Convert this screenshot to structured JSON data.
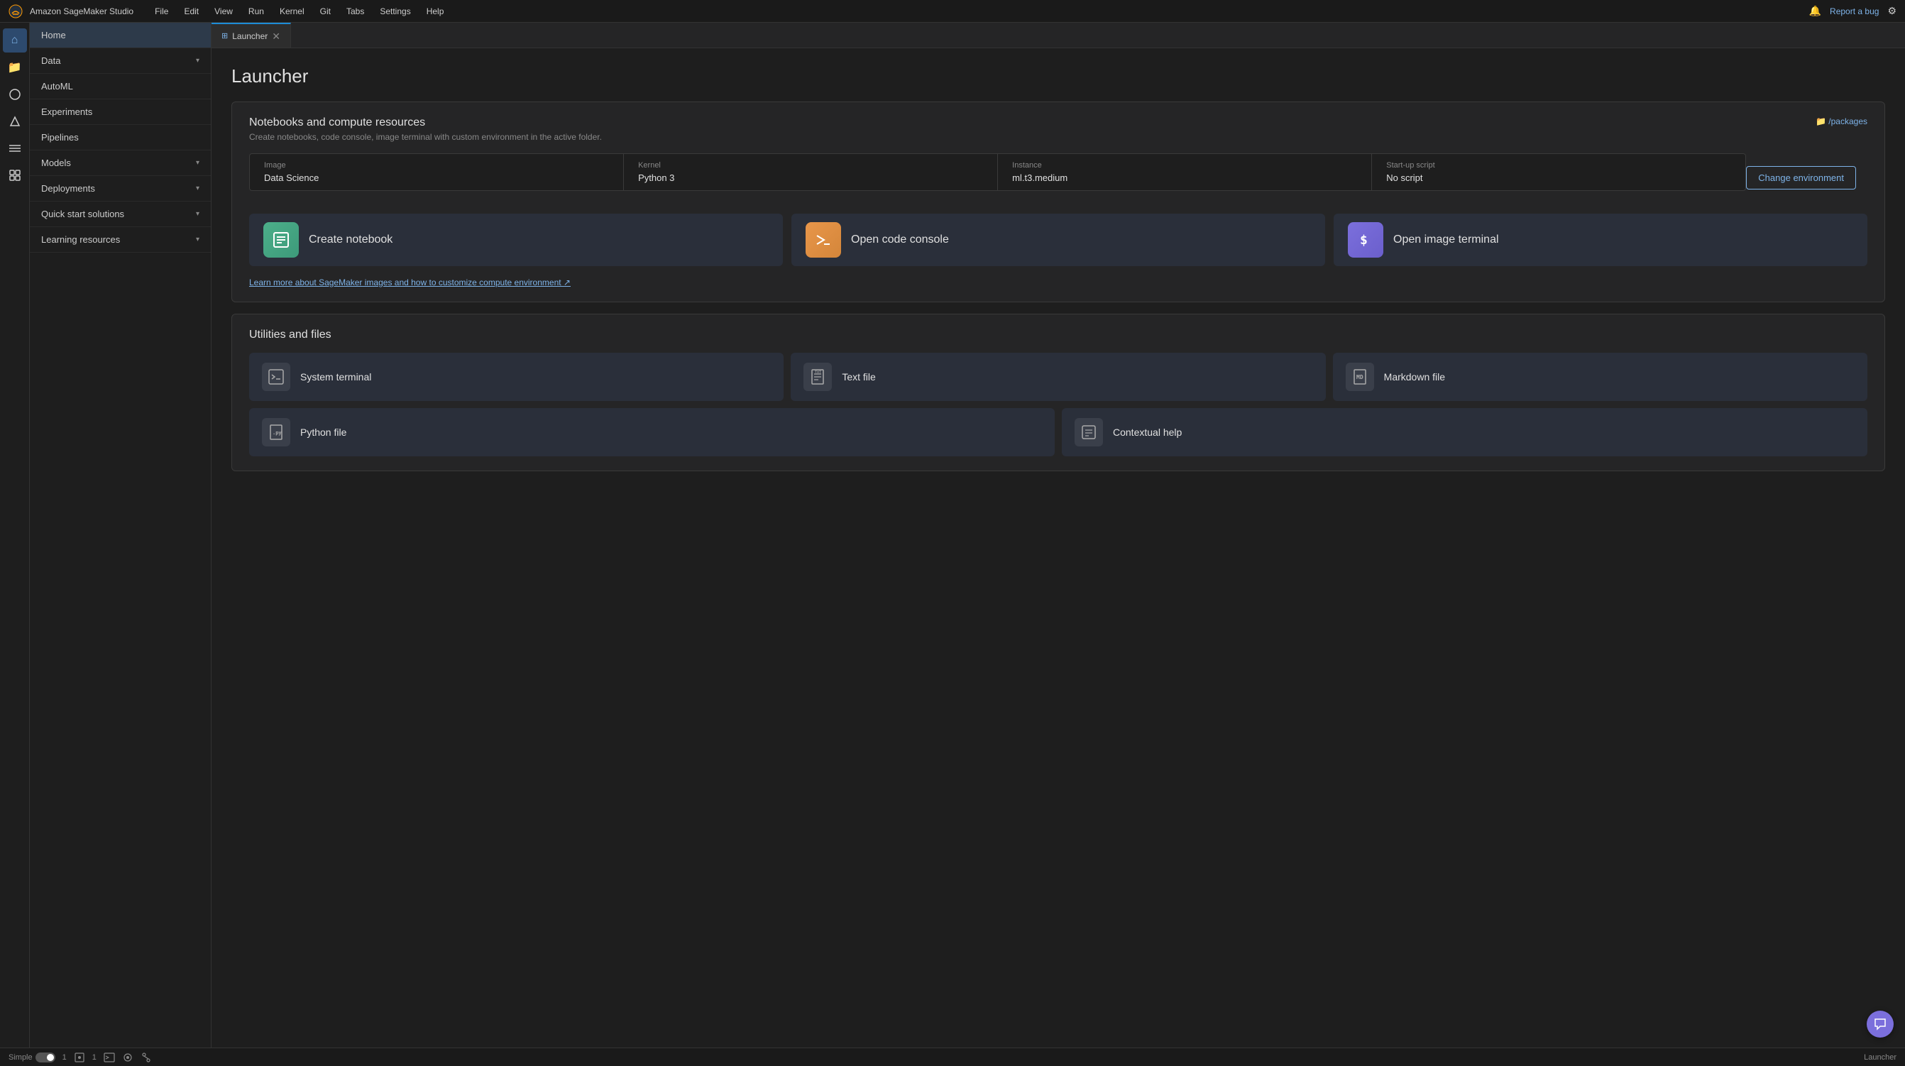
{
  "app": {
    "title": "Amazon SageMaker Studio",
    "report_bug": "Report a bug"
  },
  "menu": {
    "items": [
      "File",
      "Edit",
      "View",
      "Run",
      "Kernel",
      "Git",
      "Tabs",
      "Settings",
      "Help"
    ]
  },
  "icon_sidebar": {
    "items": [
      {
        "name": "home",
        "icon": "⌂",
        "active": true
      },
      {
        "name": "files",
        "icon": "📁",
        "active": false
      },
      {
        "name": "circle",
        "icon": "⬤",
        "active": false
      },
      {
        "name": "experiments",
        "icon": "◆",
        "active": false
      },
      {
        "name": "pipelines",
        "icon": "☰",
        "active": false
      },
      {
        "name": "puzzle",
        "icon": "🧩",
        "active": false
      }
    ]
  },
  "sidebar": {
    "items": [
      {
        "label": "Home",
        "has_chevron": false,
        "active": true
      },
      {
        "label": "Data",
        "has_chevron": true,
        "active": false
      },
      {
        "label": "AutoML",
        "has_chevron": false,
        "active": false
      },
      {
        "label": "Experiments",
        "has_chevron": false,
        "active": false
      },
      {
        "label": "Pipelines",
        "has_chevron": false,
        "active": false
      },
      {
        "label": "Models",
        "has_chevron": true,
        "active": false
      },
      {
        "label": "Deployments",
        "has_chevron": true,
        "active": false
      },
      {
        "label": "Quick start solutions",
        "has_chevron": true,
        "active": false
      },
      {
        "label": "Learning resources",
        "has_chevron": true,
        "active": false
      }
    ]
  },
  "tab": {
    "label": "Launcher",
    "icon": "⊞"
  },
  "launcher": {
    "title": "Launcher",
    "notebooks_section": {
      "title": "Notebooks and compute resources",
      "subtitle": "Create notebooks, code console, image terminal with custom environment in the active folder.",
      "folder_link": "📁 /packages",
      "env": {
        "image_label": "Image",
        "image_value": "Data Science",
        "kernel_label": "Kernel",
        "kernel_value": "Python 3",
        "instance_label": "Instance",
        "instance_value": "ml.t3.medium",
        "startup_label": "Start-up script",
        "startup_value": "No script",
        "change_btn": "Change environment"
      },
      "actions": [
        {
          "label": "Create notebook",
          "icon": "🖼",
          "name": "create-notebook"
        },
        {
          "label": "Open code console",
          "icon": "▶",
          "name": "open-code-console"
        },
        {
          "label": "Open image terminal",
          "icon": "$",
          "name": "open-image-terminal"
        }
      ],
      "learn_link": "Learn more about SageMaker images and how to customize compute environment ↗"
    },
    "utilities_section": {
      "title": "Utilities and files",
      "items": [
        {
          "label": "System terminal",
          "icon": "⬢",
          "name": "system-terminal"
        },
        {
          "label": "Text file",
          "icon": "📄",
          "name": "text-file"
        },
        {
          "label": "Markdown file",
          "icon": "📝",
          "name": "markdown-file"
        },
        {
          "label": "Python file",
          "icon": "🐍",
          "name": "python-file"
        },
        {
          "label": "Contextual help",
          "icon": "📋",
          "name": "contextual-help"
        }
      ]
    }
  },
  "status_bar": {
    "mode": "Simple",
    "kernel_count": "1",
    "terminal_count": "1",
    "launcher_label": "Launcher"
  }
}
